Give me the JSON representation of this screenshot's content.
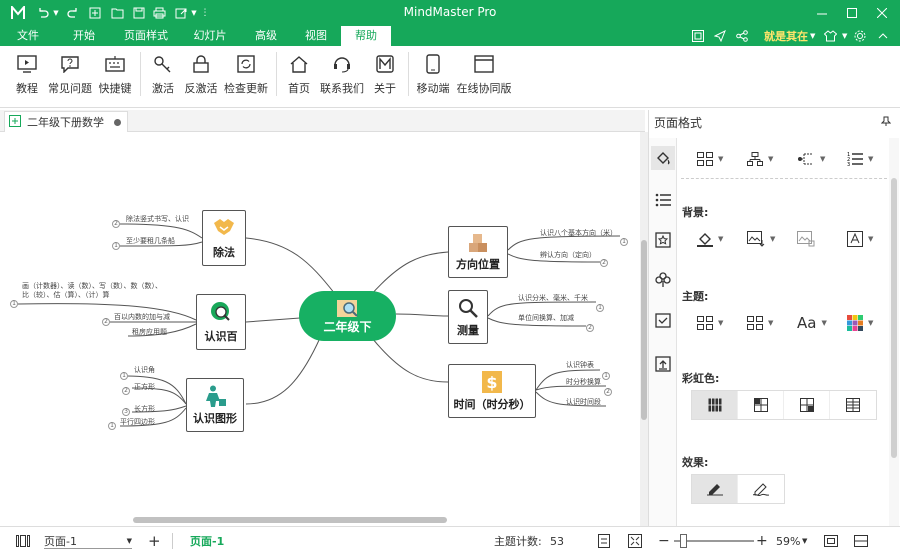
{
  "titlebar": {
    "title": "MindMaster Pro"
  },
  "menu": {
    "items": [
      "文件",
      "开始",
      "页面样式",
      "幻灯片",
      "高级",
      "视图",
      "帮助"
    ],
    "user_name": "就是其在"
  },
  "ribbon": {
    "buttons": [
      "教程",
      "常见问题",
      "快捷键",
      "激活",
      "反激活",
      "检查更新",
      "首页",
      "联系我们",
      "关于",
      "移动端",
      "在线协同版"
    ]
  },
  "document": {
    "tab_title": "二年级下册数学"
  },
  "mindmap": {
    "root": "二年级下",
    "branches": {
      "chufa": {
        "label": "除法",
        "leaves": [
          "除法竖式书写、认识",
          "至少要租几条船"
        ]
      },
      "renshibai": {
        "label": "认识百",
        "leaves": [
          "画（计数器）、读（数）、写（数）、数（数）、比（较）、估（算）、（计）算",
          "百以内数的加与减",
          "租房应用题"
        ]
      },
      "tuxing": {
        "label": "认识图形",
        "leaves": [
          "认识角",
          "正方形",
          "长方形",
          "平行四边形"
        ]
      },
      "fangxiang": {
        "label": "方向位置",
        "leaves": [
          "认识八个基本方向（米）",
          "辨认方向（定向）"
        ]
      },
      "celiang": {
        "label": "测量",
        "leaves": [
          "认识分米、毫米、千米",
          "单位间换算、加减"
        ]
      },
      "shijian": {
        "label": "时间（时分秒）",
        "leaves": [
          "认识钟表",
          "时分秒换算",
          "认识时间段"
        ]
      }
    },
    "leaf_numbers": [
      "1",
      "2",
      "3"
    ]
  },
  "panel": {
    "title": "页面格式",
    "sections": {
      "background": "背景:",
      "theme": "主题:",
      "rainbow": "彩虹色:",
      "effect": "效果:"
    },
    "font_sample": "Aa"
  },
  "status": {
    "page_select": "页面-1",
    "page_tab": "页面-1",
    "topic_count_label": "主题计数:",
    "topic_count": "53",
    "zoom": "59%",
    "minus": "−",
    "plus": "+"
  },
  "colors": {
    "brand": "#16a85a",
    "node_green": "#17b063"
  }
}
